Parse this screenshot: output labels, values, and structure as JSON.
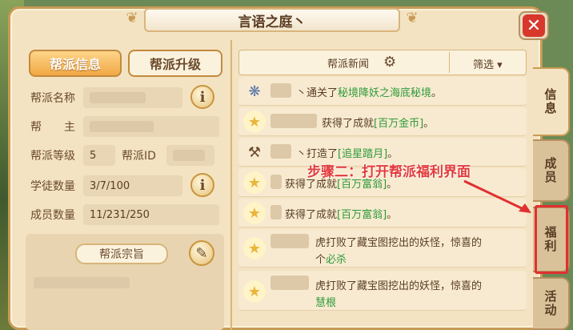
{
  "window": {
    "title": "言语之庭丶",
    "close_label": "✕"
  },
  "tabs_top": {
    "active": "帮派信息",
    "inactive": "帮派升级"
  },
  "info": {
    "name_label": "帮派名称",
    "leader_label": "帮　　主",
    "level_label": "帮派等级",
    "level_value": "5",
    "id_label": "帮派ID",
    "apprentice_label": "学徒数量",
    "apprentice_value": "3/7/100",
    "members_label": "成员数量",
    "members_value": "11/231/250",
    "info_icon": "i"
  },
  "motto": {
    "label": "帮派宗旨"
  },
  "news": {
    "title": "帮派新闻",
    "filter": "筛选 ▾",
    "items": [
      {
        "prefix": "丶通关了",
        "highlight": "秘境降妖之海底秘境",
        "suffix": "。",
        "icon": "emblem-icon"
      },
      {
        "prefix": "获得了成就",
        "highlight": "[百万金币]",
        "suffix": "。",
        "icon": "star-icon"
      },
      {
        "prefix": "丶打造了",
        "highlight": "[追星踏月]",
        "suffix": "。",
        "icon": "anvil-icon"
      },
      {
        "prefix": "获得了成就",
        "highlight": "[百万富翁]",
        "suffix": "。",
        "icon": "star-icon"
      },
      {
        "prefix": "获得了成就",
        "highlight": "[百万富翁]",
        "suffix": "。",
        "icon": "star-icon"
      },
      {
        "prefix": "虎打败了藏宝图挖出的妖怪，惊喜的",
        "line2_prefix": "个",
        "highlight": "必杀",
        "suffix": "",
        "icon": "star-icon"
      },
      {
        "prefix": "虎打败了藏宝图挖出的妖怪，惊喜的",
        "line2_prefix": "",
        "highlight": "慧根",
        "suffix": "",
        "icon": "star-icon"
      }
    ]
  },
  "side_tabs": [
    "信息",
    "成员",
    "福利",
    "活动"
  ],
  "annotation": {
    "text": "步骤二：打开帮派福利界面",
    "color": "#e23b3b"
  },
  "colors": {
    "highlight": "#2f9a3a",
    "accent": "#f0a844",
    "close": "#d8372b"
  }
}
